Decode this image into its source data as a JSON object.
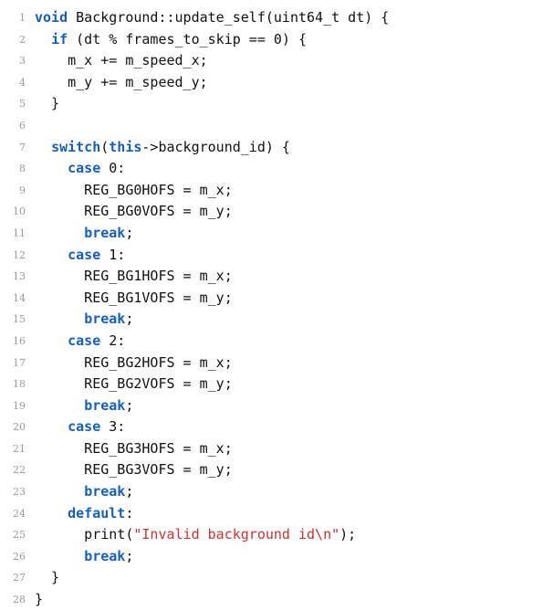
{
  "listing": {
    "lines": [
      {
        "n": "1",
        "tokens": [
          {
            "t": "void",
            "k": "kw"
          },
          {
            "t": " Background::update_self(uint64_t dt) {"
          }
        ]
      },
      {
        "n": "2",
        "tokens": [
          {
            "t": "  "
          },
          {
            "t": "if",
            "k": "kw"
          },
          {
            "t": " (dt % frames_to_skip == 0) {"
          }
        ]
      },
      {
        "n": "3",
        "tokens": [
          {
            "t": "    m_x += m_speed_x;"
          }
        ]
      },
      {
        "n": "4",
        "tokens": [
          {
            "t": "    m_y += m_speed_y;"
          }
        ]
      },
      {
        "n": "5",
        "tokens": [
          {
            "t": "  }"
          }
        ]
      },
      {
        "n": "6",
        "tokens": []
      },
      {
        "n": "7",
        "tokens": [
          {
            "t": "  "
          },
          {
            "t": "switch",
            "k": "kw"
          },
          {
            "t": "("
          },
          {
            "t": "this",
            "k": "kw"
          },
          {
            "t": "->background_id) {"
          }
        ]
      },
      {
        "n": "8",
        "tokens": [
          {
            "t": "    "
          },
          {
            "t": "case",
            "k": "kw"
          },
          {
            "t": " 0:"
          }
        ]
      },
      {
        "n": "9",
        "tokens": [
          {
            "t": "      REG_BG0HOFS = m_x;"
          }
        ]
      },
      {
        "n": "10",
        "tokens": [
          {
            "t": "      REG_BG0VOFS = m_y;"
          }
        ]
      },
      {
        "n": "11",
        "tokens": [
          {
            "t": "      "
          },
          {
            "t": "break",
            "k": "kw"
          },
          {
            "t": ";"
          }
        ]
      },
      {
        "n": "12",
        "tokens": [
          {
            "t": "    "
          },
          {
            "t": "case",
            "k": "kw"
          },
          {
            "t": " 1:"
          }
        ]
      },
      {
        "n": "13",
        "tokens": [
          {
            "t": "      REG_BG1HOFS = m_x;"
          }
        ]
      },
      {
        "n": "14",
        "tokens": [
          {
            "t": "      REG_BG1VOFS = m_y;"
          }
        ]
      },
      {
        "n": "15",
        "tokens": [
          {
            "t": "      "
          },
          {
            "t": "break",
            "k": "kw"
          },
          {
            "t": ";"
          }
        ]
      },
      {
        "n": "16",
        "tokens": [
          {
            "t": "    "
          },
          {
            "t": "case",
            "k": "kw"
          },
          {
            "t": " 2:"
          }
        ]
      },
      {
        "n": "17",
        "tokens": [
          {
            "t": "      REG_BG2HOFS = m_x;"
          }
        ]
      },
      {
        "n": "18",
        "tokens": [
          {
            "t": "      REG_BG2VOFS = m_y;"
          }
        ]
      },
      {
        "n": "19",
        "tokens": [
          {
            "t": "      "
          },
          {
            "t": "break",
            "k": "kw"
          },
          {
            "t": ";"
          }
        ]
      },
      {
        "n": "20",
        "tokens": [
          {
            "t": "    "
          },
          {
            "t": "case",
            "k": "kw"
          },
          {
            "t": " 3:"
          }
        ]
      },
      {
        "n": "21",
        "tokens": [
          {
            "t": "      REG_BG3HOFS = m_x;"
          }
        ]
      },
      {
        "n": "22",
        "tokens": [
          {
            "t": "      REG_BG3VOFS = m_y;"
          }
        ]
      },
      {
        "n": "23",
        "tokens": [
          {
            "t": "      "
          },
          {
            "t": "break",
            "k": "kw"
          },
          {
            "t": ";"
          }
        ]
      },
      {
        "n": "24",
        "tokens": [
          {
            "t": "    "
          },
          {
            "t": "default",
            "k": "kw"
          },
          {
            "t": ":"
          }
        ]
      },
      {
        "n": "25",
        "tokens": [
          {
            "t": "      print("
          },
          {
            "t": "\"Invalid background id\\n\"",
            "k": "str"
          },
          {
            "t": ");"
          }
        ]
      },
      {
        "n": "26",
        "tokens": [
          {
            "t": "      "
          },
          {
            "t": "break",
            "k": "kw"
          },
          {
            "t": ";"
          }
        ]
      },
      {
        "n": "27",
        "tokens": [
          {
            "t": "  }"
          }
        ]
      },
      {
        "n": "28",
        "tokens": [
          {
            "t": "}"
          }
        ]
      }
    ]
  }
}
